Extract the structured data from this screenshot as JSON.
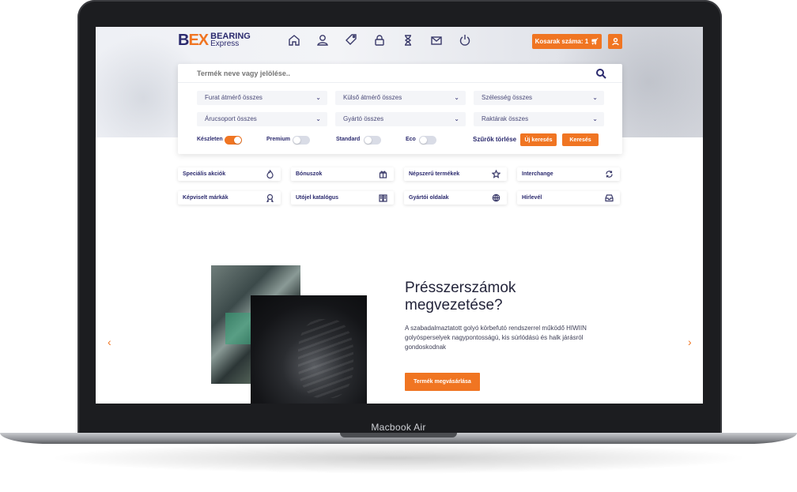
{
  "device": {
    "label": "Macbook Air"
  },
  "brand": {
    "mark_part1": "B",
    "mark_part2": "EX",
    "line1": "BEARING",
    "line2": "Express"
  },
  "header": {
    "nav_icons": [
      "home-icon",
      "user-icon",
      "tag-icon",
      "lock-icon",
      "hourglass-icon",
      "mail-icon",
      "power-icon"
    ],
    "cart_label": "Kosarak száma: 1",
    "accent_color": "#f07522",
    "brand_color": "#2b2a6e"
  },
  "search": {
    "placeholder": "Termék neve vagy jelölése.."
  },
  "filters": {
    "dropdowns": [
      "Furat átmérő összes",
      "Külső átmérő összes",
      "Szélesség összes",
      "Árucsoport összes",
      "Gyártó összes",
      "Raktárak összes"
    ],
    "toggles": [
      {
        "label": "Készleten",
        "on": true
      },
      {
        "label": "Premium",
        "on": false
      },
      {
        "label": "Standard",
        "on": false
      },
      {
        "label": "Eco",
        "on": false
      }
    ],
    "clear_label": "Szűrők törlése",
    "new_search_label": "Új keresés",
    "search_label": "Keresés"
  },
  "quick_links": [
    {
      "label": "Speciális akciók",
      "icon": "fire-icon"
    },
    {
      "label": "Bónuszok",
      "icon": "gift-icon"
    },
    {
      "label": "Népszerű termékek",
      "icon": "star-icon"
    },
    {
      "label": "Interchange",
      "icon": "refresh-icon"
    },
    {
      "label": "Képviselt márkák",
      "icon": "badge-icon"
    },
    {
      "label": "Utójel katalógus",
      "icon": "book-icon"
    },
    {
      "label": "Gyártói oldalak",
      "icon": "globe-icon"
    },
    {
      "label": "Hírlevél",
      "icon": "inbox-icon"
    }
  ],
  "slide": {
    "title_line1": "Présszerszámok",
    "title_line2": "megvezetése?",
    "text": "A szabadalmaztatott golyó körbefutó rendszerrel működő HIWIIN golyósperselyek nagypontosságú, kis súrlódású és halk járásról gondoskodnak",
    "button_label": "Termék megvásárlása",
    "prev_icon": "chevron-left-icon",
    "next_icon": "chevron-right-icon"
  }
}
